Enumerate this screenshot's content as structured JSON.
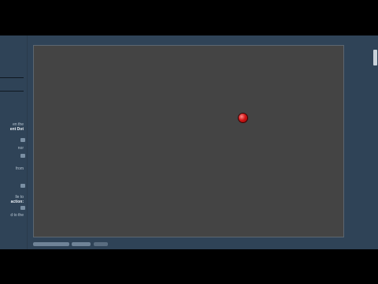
{
  "sidebar": {
    "text_lines": [
      "en the",
      "ent Dot",
      "nor",
      "from",
      "lle to",
      "action:",
      "d to the"
    ]
  },
  "canvas": {
    "dot_color": "#d01818",
    "background": "#444444"
  },
  "colors": {
    "app_background": "#2f4357",
    "canvas_border": "#5c6670"
  }
}
